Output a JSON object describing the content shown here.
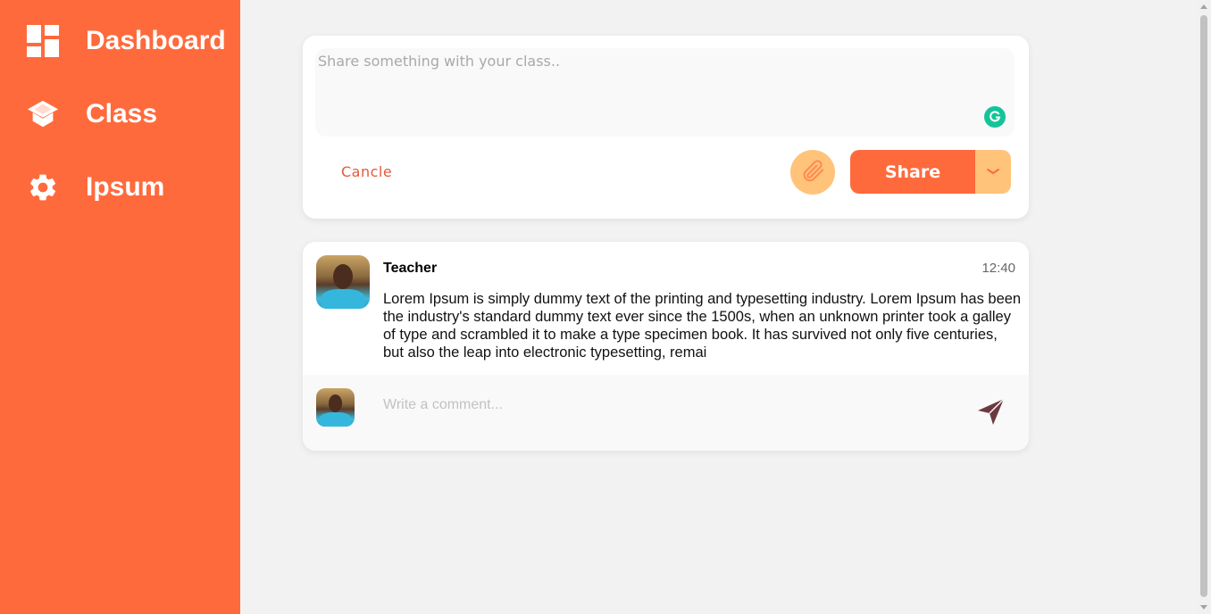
{
  "sidebar": {
    "items": [
      {
        "label": "Dashboard",
        "icon": "dashboard-icon"
      },
      {
        "label": "Class",
        "icon": "graduation-cap-icon"
      },
      {
        "label": "Ipsum",
        "icon": "gear-icon"
      }
    ]
  },
  "composer": {
    "placeholder": "Share something with your class..",
    "cancel_label": "Cancle",
    "share_label": "Share",
    "attach_icon": "paperclip-icon",
    "dropdown_icon": "chevron-down-icon"
  },
  "post": {
    "author": "Teacher",
    "time": "12:40",
    "body": "Lorem Ipsum is simply dummy text of the printing and typesetting industry. Lorem Ipsum has been the industry's standard dummy text ever since the 1500s, when an unknown printer took a galley of type and scrambled it to make a type specimen book. It has survived not only five centuries, but also the leap into electronic typesetting, remai",
    "comment_placeholder": "Write a comment...",
    "send_icon": "send-icon"
  },
  "colors": {
    "sidebar": "#ff6a3c",
    "accent_light": "#ffc37a",
    "cancel": "#e35a3a",
    "send": "#6b3a40"
  }
}
